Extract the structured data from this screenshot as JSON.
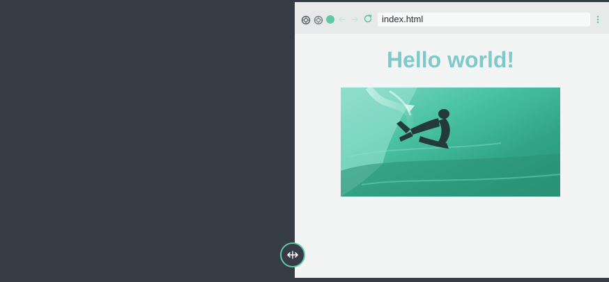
{
  "browser": {
    "address_bar": {
      "url": "index.html"
    },
    "controls": {
      "close_icon": "gear-like circle icon",
      "minimize_icon": "gear-like circle icon",
      "active_dot_color": "#5fc9a6"
    }
  },
  "page": {
    "title": "Hello world!",
    "title_color": "#7ec9c9",
    "image": "surfer-photo"
  },
  "colors": {
    "desktop_background": "#363c45",
    "accent": "#5fc9a6"
  }
}
